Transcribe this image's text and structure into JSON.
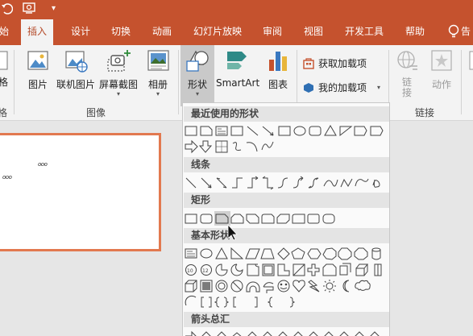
{
  "quick_access": {
    "undo_icon": "undo-icon",
    "slideshow_icon": "present-icon",
    "customize_icon": "dropdown-icon"
  },
  "tabs": [
    "始",
    "插入",
    "设计",
    "切换",
    "动画",
    "幻灯片放映",
    "审阅",
    "视图",
    "开发工具",
    "帮助",
    "告"
  ],
  "active_tab": "插入",
  "ribbon": {
    "edge_label": "格",
    "edge_group": "格",
    "picture": "图片",
    "online_picture": "联机图片",
    "screenshot": "屏幕截图",
    "album": "相册",
    "images_group": "图像",
    "shapes": "形状",
    "smartart": "SmartArt",
    "chart": "图表",
    "get_addins": "获取加载项",
    "my_addins": "我的加载项",
    "link": "链\n接",
    "link_a": "链",
    "link_b": "接",
    "action": "动作",
    "links_group": "链接"
  },
  "slide": {
    "text_a": "ooo",
    "text_b": "ooo"
  },
  "shapes_menu": {
    "categories": [
      "最近使用的形状",
      "线条",
      "矩形",
      "基本形状",
      "箭头总汇"
    ]
  },
  "colors": {
    "accent": "#c5522e",
    "slide_border": "#e2794f"
  }
}
